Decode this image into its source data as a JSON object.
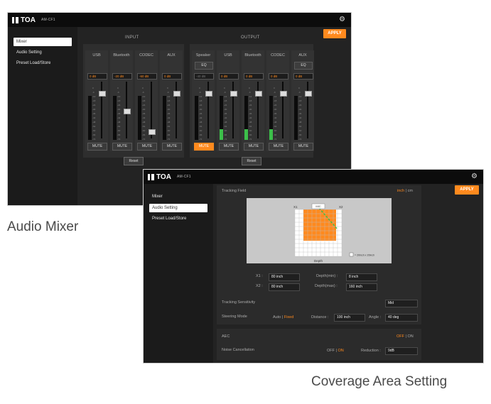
{
  "brand": "TOA",
  "model": "AM-CF1",
  "apply_label": "APPLY",
  "sidebar": [
    "Mixer",
    "Audio Setting",
    "Preset Load/Store"
  ],
  "mixer": {
    "input_label": "INPUT",
    "output_label": "OUTPUT",
    "eq_label": "EQ",
    "mute_label": "MUTE",
    "reset_label": "Reset",
    "scale": [
      "0",
      "-6",
      "-12",
      "-18",
      "-24",
      "-30",
      "-36",
      "-42",
      "-48",
      "-54",
      "-60",
      "-66",
      "-72"
    ],
    "input_channels": [
      {
        "name": "USB",
        "value": "0 dB",
        "fader": 0.83,
        "level": 0
      },
      {
        "name": "Bluetooth",
        "value": "-20 dB",
        "fader": 0.48,
        "level": 0
      },
      {
        "name": "CODEC",
        "value": "-60 dB",
        "fader": 0.1,
        "level": 0
      },
      {
        "name": "AUX",
        "value": "0 dB",
        "fader": 0.83,
        "level": 0
      }
    ],
    "output_channels": [
      {
        "name": "Speaker",
        "value": "-40 dB",
        "fader": 0.83,
        "level": 0,
        "eq": true,
        "muted": true
      },
      {
        "name": "USB",
        "value": "0 dB",
        "fader": 0.83,
        "level": 0.24,
        "eq": false,
        "muted": false
      },
      {
        "name": "Bluetooth",
        "value": "0 dB",
        "fader": 0.83,
        "level": 0.24,
        "eq": false,
        "muted": false
      },
      {
        "name": "CODEC",
        "value": "0 dB",
        "fader": 0.83,
        "level": 0.24,
        "eq": false,
        "muted": false
      },
      {
        "name": "AUX",
        "value": "0 dB",
        "fader": 0.83,
        "level": 0,
        "eq": true,
        "muted": false
      }
    ]
  },
  "caption_mixer": "Audio Mixer",
  "caption_coverage": "Coverage Area Setting",
  "coverage": {
    "tracking_field": "Tracking Field",
    "unit_inch": "inch",
    "unit_sep": "|",
    "unit_cm": "cm",
    "mic_label": "MIC",
    "x1_axis": "X1",
    "x2_axis": "X2",
    "depth_axis": "Depth",
    "grid_legend": "= 20inch x 20inch",
    "x1_label": "X1 :",
    "x1_value": "80 inch",
    "x2_label": "X2 :",
    "x2_value": "80 inch",
    "depth_min_label": "Depth(min) :",
    "depth_min_value": "8 inch",
    "depth_max_label": "Depth(max) :",
    "depth_max_value": "160 inch",
    "sensitivity_label": "Tracking Sensitivity",
    "sensitivity_value": "Mid",
    "steering_label": "Steering Mode",
    "steer_auto": "Auto",
    "steer_fixed": "Fixed",
    "distance_label": "Distance :",
    "distance_value": "100 inch",
    "angle_label": "Angle :",
    "angle_value": "40 deg",
    "aec_label": "AEC",
    "aec_off": "OFF",
    "aec_on": "ON",
    "nc_label": "Noise Cancellation",
    "nc_off": "OFF",
    "nc_on": "ON",
    "reduction_label": "Reduction :",
    "reduction_value": "9dB"
  }
}
